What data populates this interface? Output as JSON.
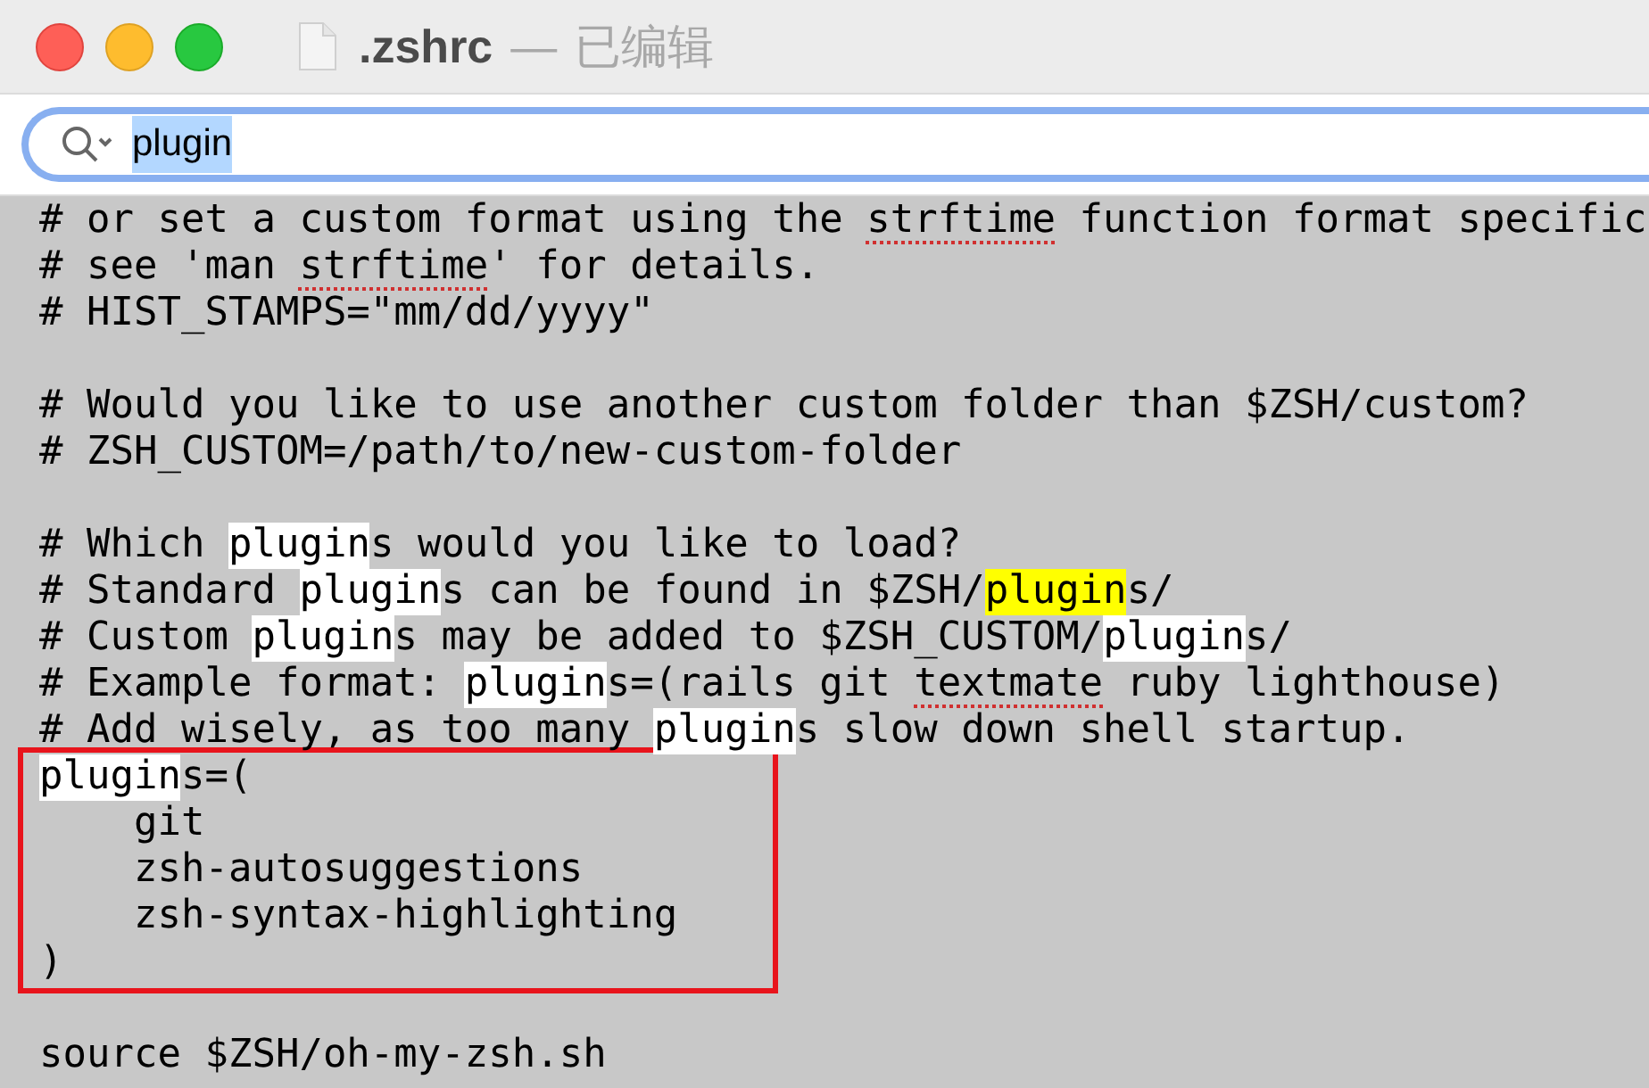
{
  "window": {
    "title": ".zshrc",
    "separator": "—",
    "status": "已编辑"
  },
  "search": {
    "value": "plugin",
    "selected_text": true
  },
  "editor": {
    "sections": [
      {
        "boxed": false,
        "lines": [
          {
            "segments": [
              {
                "kind": "plain",
                "text": "# or set a custom format using the "
              },
              {
                "kind": "misspelled",
                "text": "strftime"
              },
              {
                "kind": "plain",
                "text": " function format specific"
              }
            ]
          },
          {
            "segments": [
              {
                "kind": "plain",
                "text": "# see 'man "
              },
              {
                "kind": "misspelled",
                "text": "strftime"
              },
              {
                "kind": "plain",
                "text": "' for details."
              }
            ]
          },
          {
            "segments": [
              {
                "kind": "plain",
                "text": "# HIST_STAMPS=\"mm/dd/yyyy\""
              }
            ]
          },
          {
            "blank": true
          },
          {
            "segments": [
              {
                "kind": "plain",
                "text": "# Would you like to use another custom folder than $ZSH/custom?"
              }
            ]
          },
          {
            "segments": [
              {
                "kind": "plain",
                "text": "# ZSH_CUSTOM=/path/to/new-custom-folder"
              }
            ]
          },
          {
            "blank": true
          },
          {
            "segments": [
              {
                "kind": "plain",
                "text": "# Which "
              },
              {
                "kind": "match",
                "text": "plugin"
              },
              {
                "kind": "plain",
                "text": "s would you like to load?"
              }
            ]
          },
          {
            "segments": [
              {
                "kind": "plain",
                "text": "# Standard "
              },
              {
                "kind": "match",
                "text": "plugin"
              },
              {
                "kind": "plain",
                "text": "s can be found in $ZSH/"
              },
              {
                "kind": "current",
                "text": "plugin"
              },
              {
                "kind": "plain",
                "text": "s/"
              }
            ]
          },
          {
            "segments": [
              {
                "kind": "plain",
                "text": "# Custom "
              },
              {
                "kind": "match",
                "text": "plugin"
              },
              {
                "kind": "plain",
                "text": "s may be added to $ZSH_CUSTOM/"
              },
              {
                "kind": "match",
                "text": "plugin"
              },
              {
                "kind": "plain",
                "text": "s/"
              }
            ]
          },
          {
            "segments": [
              {
                "kind": "plain",
                "text": "# Example format: "
              },
              {
                "kind": "match",
                "text": "plugin"
              },
              {
                "kind": "plain",
                "text": "s=(rails git "
              },
              {
                "kind": "misspelled",
                "text": "textmate"
              },
              {
                "kind": "plain",
                "text": " ruby lighthouse)"
              }
            ]
          },
          {
            "segments": [
              {
                "kind": "plain",
                "text": "# Add wisely, as too many "
              },
              {
                "kind": "match",
                "text": "plugin"
              },
              {
                "kind": "plain",
                "text": "s slow down shell startup."
              }
            ]
          }
        ]
      },
      {
        "boxed": true,
        "lines": [
          {
            "segments": [
              {
                "kind": "match",
                "text": "plugin"
              },
              {
                "kind": "plain",
                "text": "s=("
              }
            ]
          },
          {
            "segments": [
              {
                "kind": "plain",
                "text": "    git"
              }
            ]
          },
          {
            "segments": [
              {
                "kind": "plain",
                "text": "    zsh-autosuggestions"
              }
            ]
          },
          {
            "segments": [
              {
                "kind": "plain",
                "text": "    zsh-syntax-highlighting"
              }
            ]
          },
          {
            "segments": [
              {
                "kind": "plain",
                "text": ")"
              }
            ]
          }
        ]
      },
      {
        "boxed": false,
        "lines": [
          {
            "blank": true
          },
          {
            "segments": [
              {
                "kind": "plain",
                "text": "source $ZSH/oh-my-zsh.sh"
              }
            ]
          }
        ]
      }
    ]
  }
}
